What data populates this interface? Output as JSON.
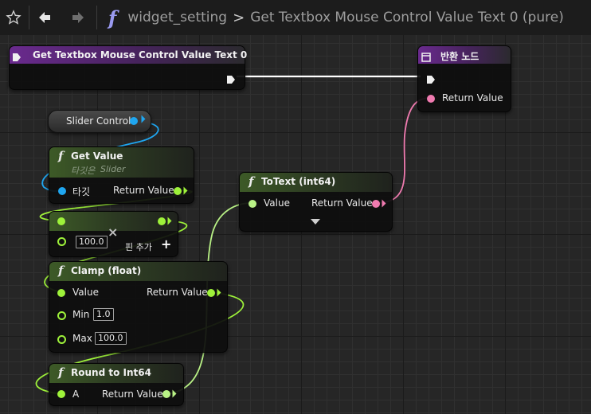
{
  "toolbar": {
    "function_symbol": "f",
    "breadcrumb_root": "widget_setting",
    "breadcrumb_separator": ">",
    "breadcrumb_current": "Get Textbox Mouse Control Value Text 0 (pure)"
  },
  "nodes": {
    "entry": {
      "title": "Get Textbox Mouse Control Value Text 0"
    },
    "return": {
      "title": "반환 노드",
      "return_value": "Return Value"
    },
    "slider_var": {
      "label": "Slider Control"
    },
    "get_value": {
      "title": "Get Value",
      "subtitle_prefix": "타깃은",
      "subtitle_target": "Slider",
      "target_label": "타깃",
      "return_value": "Return Value"
    },
    "multiply": {
      "value": "100.0",
      "add_pin": "핀 추가",
      "remove_symbol": "×"
    },
    "clamp": {
      "title": "Clamp (float)",
      "value_label": "Value",
      "return_value": "Return Value",
      "min_label": "Min",
      "min_value": "1.0",
      "max_label": "Max",
      "max_value": "100.0"
    },
    "round": {
      "title": "Round to Int64",
      "a_label": "A",
      "return_value": "Return Value"
    },
    "totext": {
      "title": "ToText (int64)",
      "value_label": "Value",
      "return_value": "Return Value"
    }
  },
  "icons": {
    "star": "star-icon",
    "back": "arrow-left-icon",
    "forward": "arrow-right-icon",
    "function": "function-icon",
    "exec": "exec-pin-icon",
    "expand": "triangle-down-icon"
  },
  "colors": {
    "float_pin": "#9ef23a",
    "int64_pin": "#b9f286",
    "object_pin": "#1fa6f0",
    "text_pin": "#f07bb0",
    "exec_wire": "#ffffff",
    "pure_header": "#3d5a27",
    "entry_header": "#6a2a8e"
  }
}
